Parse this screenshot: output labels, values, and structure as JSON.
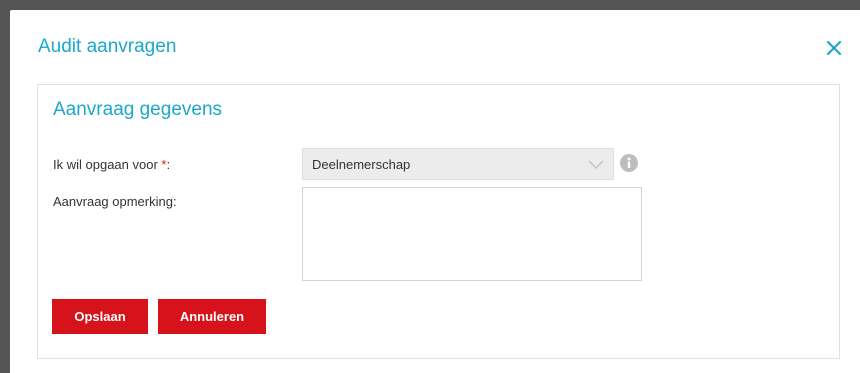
{
  "dialog": {
    "title": "Audit aanvragen",
    "close_icon": "close-icon"
  },
  "form": {
    "section_title": "Aanvraag gegevens",
    "field_type": {
      "label": "Ik wil opgaan voor ",
      "required_marker": "*",
      "label_suffix": ":",
      "selected_value": "Deelnemerschap",
      "icon": "chevron-down-icon",
      "info_icon": "info-icon"
    },
    "field_remark": {
      "label": "Aanvraag opmerking:",
      "value": ""
    }
  },
  "actions": {
    "save_label": "Opslaan",
    "cancel_label": "Annuleren"
  },
  "colors": {
    "accent": "#1ba8c9",
    "primary_button": "#d6131b",
    "required": "#d9141c"
  }
}
